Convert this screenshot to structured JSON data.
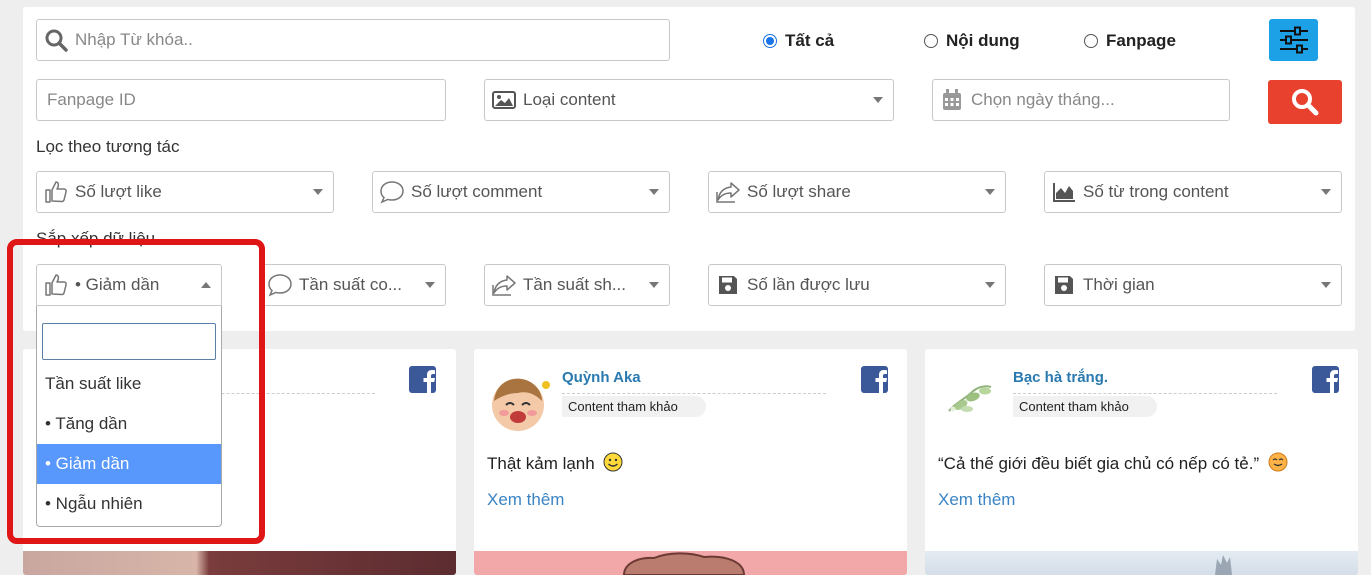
{
  "search": {
    "placeholder": "Nhập Từ khóa.."
  },
  "scope": {
    "options": [
      {
        "label": "Tất cả",
        "selected": true
      },
      {
        "label": "Nội dung",
        "selected": false
      },
      {
        "label": "Fanpage",
        "selected": false
      }
    ]
  },
  "filters": {
    "fanpage_id_placeholder": "Fanpage ID",
    "content_type": "Loại content",
    "date_placeholder": "Chọn ngày tháng..."
  },
  "interaction": {
    "heading": "Lọc theo tương tác",
    "like": "Số lượt like",
    "comment": "Số lượt comment",
    "share": "Số lượt share",
    "word_count": "Số từ trong content"
  },
  "sort": {
    "heading": "Sắp xếp dữ liệu",
    "like": "• Giảm dần",
    "comment": "Tần suất co...",
    "share": "Tần suất sh...",
    "saved": "Số lần được lưu",
    "time": "Thời gian"
  },
  "dropdown": {
    "options": [
      "Tần suất like",
      "• Tăng dần",
      "• Giảm dần",
      "• Ngẫu nhiên"
    ],
    "selected_index": 2
  },
  "cards": [
    {
      "name": "",
      "tag": "",
      "body": "",
      "more": ""
    },
    {
      "name": "Quỳnh Aka",
      "tag": "Content tham khảo",
      "body": "Thật kảm lạnh",
      "more": "Xem thêm"
    },
    {
      "name": "Bạc hà trắng.",
      "tag": "Content tham khảo",
      "body": "“Cả thế giới đều biết gia chủ có nếp có tẻ.”",
      "more": "Xem thêm"
    }
  ],
  "colors": {
    "settings_button": "#1da1e6",
    "search_button": "#e8412d",
    "highlight": "#e01515",
    "selected_option": "#5897fb"
  }
}
